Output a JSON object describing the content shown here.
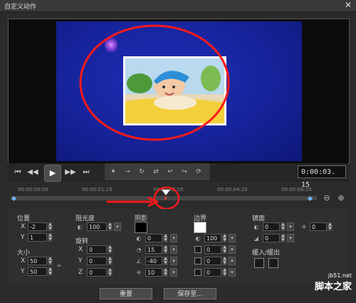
{
  "window": {
    "title": "自定义动作",
    "close_glyph": "✕"
  },
  "player": {
    "timecode": "0:00:03. 15",
    "controls": [
      {
        "name": "go-start-button",
        "glyph": "⏮"
      },
      {
        "name": "prev-frame-button",
        "glyph": "◀◀"
      },
      {
        "name": "play-button",
        "glyph": "▶"
      },
      {
        "name": "next-frame-button",
        "glyph": "▶▶"
      },
      {
        "name": "go-end-button",
        "glyph": "⏭"
      }
    ],
    "keyframe_tools": [
      "✦",
      "⊸",
      "↻",
      "⇄",
      "↩",
      "↪",
      "⟳"
    ]
  },
  "timeline": {
    "ticks": [
      "00:00:00:00",
      "00:00:01:15",
      "00:00:03:05",
      "00:00:04:20",
      "00:00:06:10"
    ],
    "zoom_out_glyph": "⊖",
    "zoom_in_glyph": "⊕"
  },
  "position": {
    "label": "位置",
    "x_label": "X",
    "x_value": "-2",
    "y_label": "Y",
    "y_value": "1"
  },
  "size": {
    "label": "大小",
    "x_label": "X",
    "x_value": "50",
    "y_label": "Y",
    "y_value": "50"
  },
  "opacity": {
    "label": "阻光度",
    "value": "100"
  },
  "rotation": {
    "label": "旋转",
    "x_label": "X",
    "x_value": "0",
    "y_label": "Y",
    "y_value": "0",
    "z_label": "Z",
    "z_value": "0"
  },
  "shadow": {
    "label": "阴影",
    "color": "#000000",
    "opacity_value": "0",
    "blur_value": "15",
    "angle_value": "-40",
    "distance_value": "10"
  },
  "border": {
    "label": "边界",
    "color": "#ffffff",
    "opacity_value": "100",
    "width_value": "0",
    "blur_value": "0",
    "color2_value": "0"
  },
  "mirror": {
    "label": "镜面",
    "opacity_value": "0",
    "fade_value": "0",
    "offset_value": "0"
  },
  "ease": {
    "label": "缓入/缓出"
  },
  "buttons": {
    "reset": "重置",
    "save": "保存至..."
  },
  "watermark": {
    "site": "jb51.net",
    "name": "脚本之家"
  }
}
